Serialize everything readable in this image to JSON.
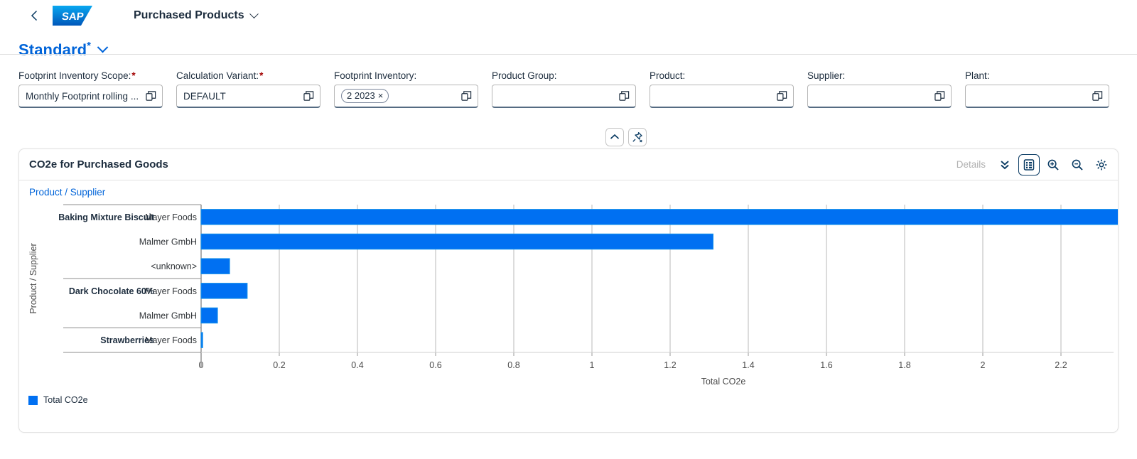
{
  "shell": {
    "back_icon": "chevron-left-icon",
    "logo": "sap-logo",
    "app_title": "Purchased Products",
    "title_chevron": "chevron-down-icon"
  },
  "variant": {
    "name": "Standard",
    "modified_marker": "*",
    "chevron": "chevron-down-icon"
  },
  "filters": [
    {
      "label": "Footprint Inventory Scope:",
      "required": true,
      "value": "Monthly Footprint rolling ...",
      "placeholder": "",
      "token": null,
      "value_help_icon": "value-help-icon",
      "name": "footprint-inventory-scope"
    },
    {
      "label": "Calculation Variant:",
      "required": true,
      "value": "DEFAULT",
      "placeholder": "",
      "token": null,
      "value_help_icon": "value-help-icon",
      "name": "calculation-variant"
    },
    {
      "label": "Footprint Inventory:",
      "required": false,
      "value": "",
      "placeholder": "",
      "token": "2 2023",
      "token_remove": "×",
      "value_help_icon": "value-help-icon",
      "name": "footprint-inventory"
    },
    {
      "label": "Product Group:",
      "required": false,
      "value": "",
      "placeholder": "",
      "token": null,
      "value_help_icon": "value-help-icon",
      "name": "product-group"
    },
    {
      "label": "Product:",
      "required": false,
      "value": "",
      "placeholder": "",
      "token": null,
      "value_help_icon": "value-help-icon",
      "name": "product"
    },
    {
      "label": "Supplier:",
      "required": false,
      "value": "",
      "placeholder": "",
      "token": null,
      "value_help_icon": "value-help-icon",
      "name": "supplier"
    },
    {
      "label": "Plant:",
      "required": false,
      "value": "",
      "placeholder": "",
      "token": null,
      "value_help_icon": "value-help-icon",
      "name": "plant"
    }
  ],
  "filter_actions": {
    "collapse_icon": "chevron-up-icon",
    "pin_icon": "pin-off-icon"
  },
  "card": {
    "title": "CO2e for Purchased Goods",
    "breadcrumb": "Product / Supplier",
    "details_label": "Details",
    "tools": [
      {
        "name": "drill-down-icon",
        "icon": "double-chevron-down",
        "selected": false
      },
      {
        "name": "chart-table-toggle-icon",
        "icon": "table",
        "selected": true
      },
      {
        "name": "zoom-in-icon",
        "icon": "magnifier-plus",
        "selected": false
      },
      {
        "name": "zoom-out-icon",
        "icon": "magnifier-minus",
        "selected": false
      },
      {
        "name": "settings-icon",
        "icon": "gear",
        "selected": false
      }
    ]
  },
  "chart_data": {
    "type": "bar",
    "orientation": "horizontal",
    "title": "CO2e for Purchased Goods",
    "xlabel": "Total CO2e",
    "ylabel": "Product / Supplier",
    "xlim": [
      0,
      2.3
    ],
    "xticks": [
      0,
      0.2,
      0.4,
      0.6,
      0.8,
      1,
      1.2,
      1.4,
      1.6,
      1.8,
      2,
      2.2
    ],
    "xtick_labels": [
      "0",
      "0.2",
      "0.4",
      "0.6",
      "0.8",
      "1",
      "1.2",
      "1.4",
      "1.6",
      "1.8",
      "2",
      "2.2"
    ],
    "grid": true,
    "legend": [
      {
        "name": "Total CO2e",
        "color": "#0070f2"
      }
    ],
    "legend_position": "bottom-left",
    "bar_color": "#0070f2",
    "groups": [
      {
        "product": "Baking Mixture Biscuit",
        "rows": [
          {
            "supplier": "Mayer Foods",
            "value": 2.35,
            "clipped": true
          },
          {
            "supplier": "Malmer GmbH",
            "value": 1.31,
            "clipped": false
          },
          {
            "supplier": "<unknown>",
            "value": 0.073,
            "clipped": false
          }
        ]
      },
      {
        "product": "Dark Chocolate 60%",
        "rows": [
          {
            "supplier": "Mayer Foods",
            "value": 0.118,
            "clipped": false
          },
          {
            "supplier": "Malmer GmbH",
            "value": 0.042,
            "clipped": false
          }
        ]
      },
      {
        "product": "Strawberries",
        "rows": [
          {
            "supplier": "Mayer Foods",
            "value": 0.004,
            "clipped": false
          }
        ]
      }
    ]
  },
  "colors": {
    "accent": "#0064d9",
    "bar": "#0070f2",
    "dark_blue": "#0a3b63",
    "text": "#1d2d3e",
    "required": "#a20000"
  }
}
